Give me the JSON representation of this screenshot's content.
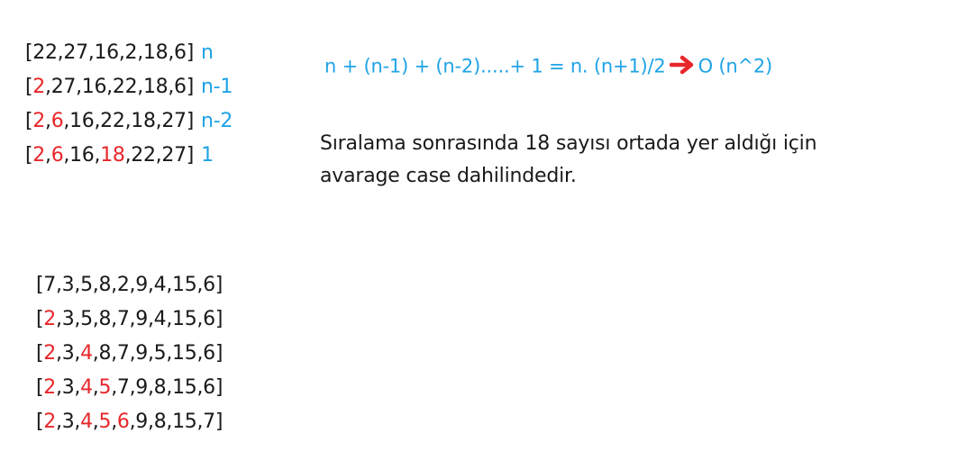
{
  "top_block": {
    "lines": [
      {
        "tokens": [
          {
            "t": "[22,27,16,2,18,6]",
            "c": "dark"
          },
          {
            "t": "n",
            "c": "step"
          }
        ]
      },
      {
        "tokens": [
          {
            "t": "[",
            "c": "dark"
          },
          {
            "t": "2",
            "c": "red"
          },
          {
            "t": ",27,16,22,18,6]",
            "c": "dark"
          },
          {
            "t": "n-1",
            "c": "step"
          }
        ]
      },
      {
        "tokens": [
          {
            "t": "[",
            "c": "dark"
          },
          {
            "t": "2",
            "c": "red"
          },
          {
            "t": ",",
            "c": "dark"
          },
          {
            "t": "6",
            "c": "red"
          },
          {
            "t": ",16,22,18,27]",
            "c": "dark"
          },
          {
            "t": "n-2",
            "c": "step"
          }
        ]
      },
      {
        "tokens": [
          {
            "t": "[",
            "c": "dark"
          },
          {
            "t": "2",
            "c": "red"
          },
          {
            "t": ",",
            "c": "dark"
          },
          {
            "t": "6",
            "c": "red"
          },
          {
            "t": ",16,",
            "c": "dark"
          },
          {
            "t": "18",
            "c": "red"
          },
          {
            "t": ",22,27]",
            "c": "dark"
          },
          {
            "t": "1",
            "c": "step"
          }
        ]
      }
    ]
  },
  "formula": {
    "text": "n + (n-1) + (n-2).....+ 1 = n. (n+1)/2",
    "result": "O (n^2)",
    "arrow_icon": "right-arrow-icon",
    "arrow_color": "#e8262a"
  },
  "note": {
    "line1": "Sıralama sonrasında 18 sayısı ortada yer aldığı için",
    "line2": "avarage case dahilindedir."
  },
  "bottom_block": {
    "lines": [
      {
        "tokens": [
          {
            "t": "[7,3,5,8,2,9,4,15,6]",
            "c": "dark"
          }
        ]
      },
      {
        "tokens": [
          {
            "t": "[",
            "c": "dark"
          },
          {
            "t": "2",
            "c": "red"
          },
          {
            "t": ",3,5,8,7,9,4,15,6]",
            "c": "dark"
          }
        ]
      },
      {
        "tokens": [
          {
            "t": "[",
            "c": "dark"
          },
          {
            "t": "2",
            "c": "red"
          },
          {
            "t": ",3,",
            "c": "dark"
          },
          {
            "t": "4",
            "c": "red"
          },
          {
            "t": ",8,7,9,5,15,6]",
            "c": "dark"
          }
        ]
      },
      {
        "tokens": [
          {
            "t": "[",
            "c": "dark"
          },
          {
            "t": "2",
            "c": "red"
          },
          {
            "t": ",3,",
            "c": "dark"
          },
          {
            "t": "4",
            "c": "red"
          },
          {
            "t": ",",
            "c": "dark"
          },
          {
            "t": "5",
            "c": "red"
          },
          {
            "t": ",7,9,8,15,6]",
            "c": "dark"
          }
        ]
      },
      {
        "tokens": [
          {
            "t": "[",
            "c": "dark"
          },
          {
            "t": "2",
            "c": "red"
          },
          {
            "t": ",3,",
            "c": "dark"
          },
          {
            "t": "4",
            "c": "red"
          },
          {
            "t": ",",
            "c": "dark"
          },
          {
            "t": "5",
            "c": "red"
          },
          {
            "t": ",",
            "c": "dark"
          },
          {
            "t": "6",
            "c": "red"
          },
          {
            "t": ",9,8,15,7]",
            "c": "dark"
          }
        ]
      }
    ]
  },
  "colors": {
    "highlight": "#e8262a",
    "step_label": "#1ea3e6",
    "text": "#1a1a1a"
  }
}
